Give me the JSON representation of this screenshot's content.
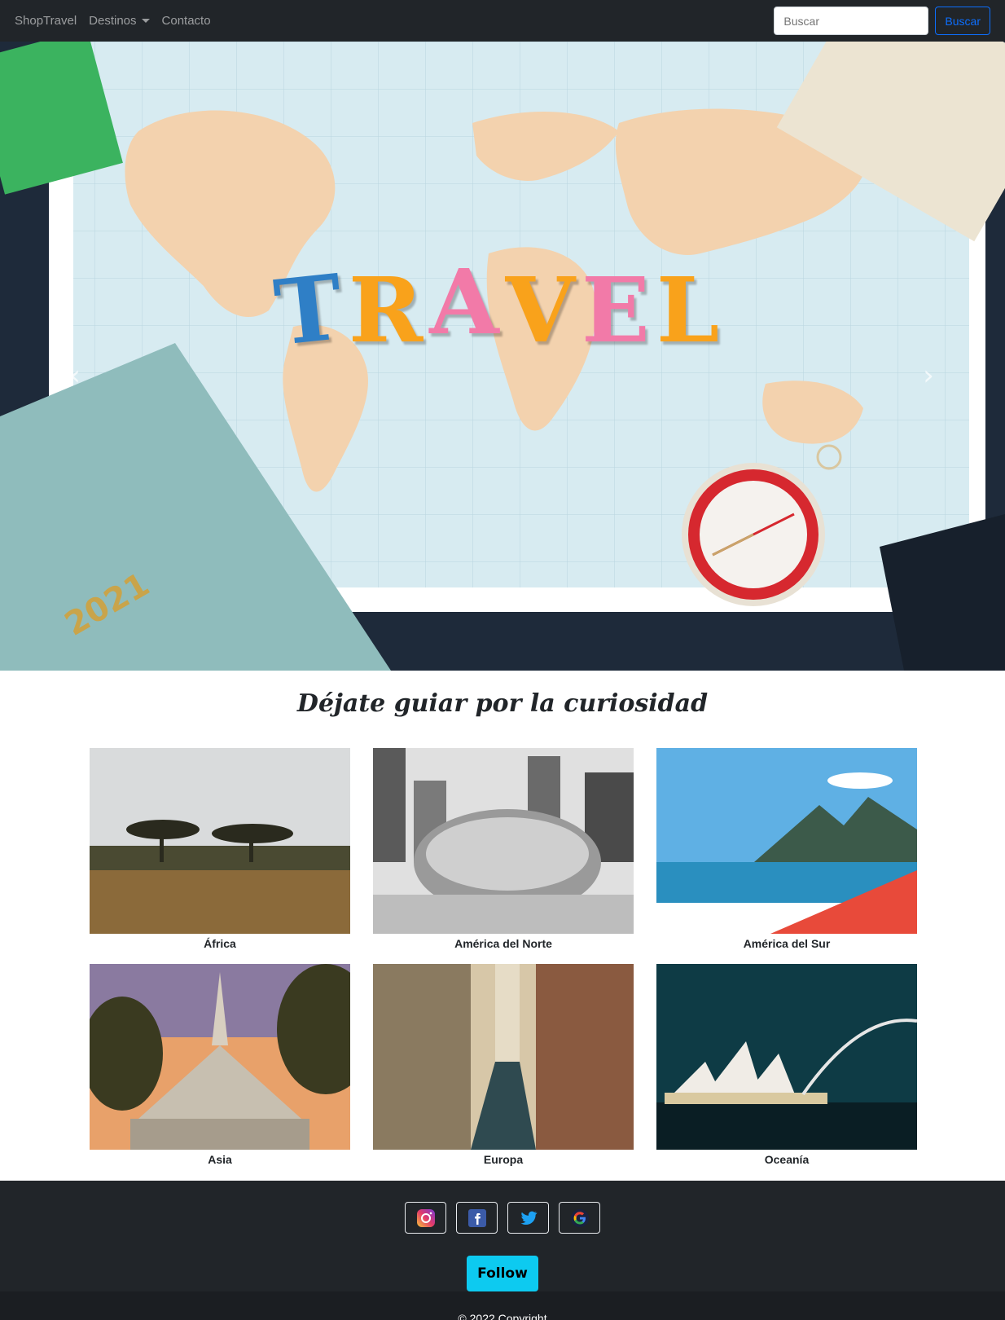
{
  "navbar": {
    "brand": "ShopTravel",
    "links": [
      {
        "label": "Destinos",
        "dropdown": true
      },
      {
        "label": "Contacto",
        "dropdown": false
      }
    ],
    "search": {
      "placeholder": "Buscar",
      "button_label": "Buscar"
    }
  },
  "hero": {
    "letters": [
      {
        "char": "T",
        "color": "#2f7fc6"
      },
      {
        "char": "R",
        "color": "#f9a21b"
      },
      {
        "char": "A",
        "color": "#f27aa8"
      },
      {
        "char": "V",
        "color": "#f9a21b"
      },
      {
        "char": "E",
        "color": "#f27aa8"
      },
      {
        "char": "L",
        "color": "#f9a21b"
      }
    ],
    "notebook_year": "2021"
  },
  "section": {
    "title": "Déjate guiar por la curiosidad",
    "destinations": [
      {
        "label": "África"
      },
      {
        "label": "América del Norte"
      },
      {
        "label": "América del Sur"
      },
      {
        "label": "Asia"
      },
      {
        "label": "Europa"
      },
      {
        "label": "Oceanía"
      }
    ]
  },
  "footer": {
    "social": [
      {
        "icon": "instagram-icon"
      },
      {
        "icon": "facebook-icon"
      },
      {
        "icon": "twitter-icon"
      },
      {
        "icon": "google-icon"
      }
    ],
    "follow_label": "Follow",
    "copyright": "© 2022 Copyright"
  },
  "colors": {
    "navbar_bg": "#212529",
    "accent_blue": "#0d6efd",
    "follow_cyan": "#0dcaf0"
  }
}
